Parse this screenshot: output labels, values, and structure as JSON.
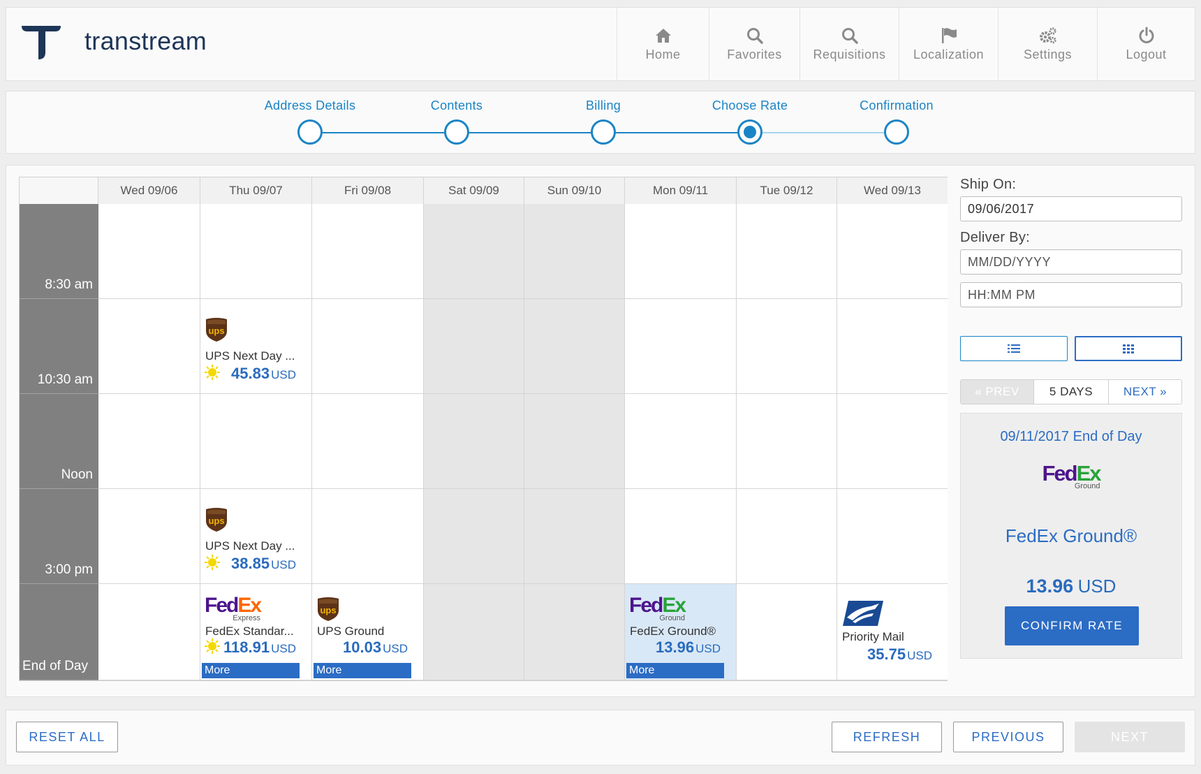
{
  "app": {
    "name": "transtream"
  },
  "nav": [
    {
      "label": "Home",
      "icon": "home-icon"
    },
    {
      "label": "Favorites",
      "icon": "search-icon"
    },
    {
      "label": "Requisitions",
      "icon": "search-icon"
    },
    {
      "label": "Localization",
      "icon": "flag-icon"
    },
    {
      "label": "Settings",
      "icon": "gears-icon"
    },
    {
      "label": "Logout",
      "icon": "power-icon"
    }
  ],
  "steps": [
    {
      "label": "Address Details",
      "state": "done"
    },
    {
      "label": "Contents",
      "state": "done"
    },
    {
      "label": "Billing",
      "state": "done"
    },
    {
      "label": "Choose Rate",
      "state": "active"
    },
    {
      "label": "Confirmation",
      "state": "pending"
    }
  ],
  "calendar": {
    "days": [
      "Wed 09/06",
      "Thu 09/07",
      "Fri 09/08",
      "Sat 09/09",
      "Sun 09/10",
      "Mon 09/11",
      "Tue 09/12",
      "Wed 09/13"
    ],
    "times": [
      "8:30 am",
      "10:30 am",
      "Noon",
      "3:00 pm",
      "End of Day"
    ],
    "rates": [
      {
        "carrier": "ups",
        "service": "UPS Next Day ...",
        "price": "45.83",
        "currency": "USD",
        "more": ""
      },
      {
        "carrier": "ups",
        "service": "UPS Next Day ...",
        "price": "38.85",
        "currency": "USD",
        "more": ""
      },
      {
        "carrier": "fedex-express",
        "service": "FedEx Standar...",
        "price": "118.91",
        "currency": "USD",
        "more": "More"
      },
      {
        "carrier": "ups",
        "service": "UPS Ground",
        "price": "10.03",
        "currency": "USD",
        "more": "More"
      },
      {
        "carrier": "fedex-ground",
        "service": "FedEx Ground®",
        "price": "13.96",
        "currency": "USD",
        "more": "More"
      },
      {
        "carrier": "usps",
        "service": "Priority Mail",
        "price": "35.75",
        "currency": "USD",
        "more": ""
      }
    ],
    "fedex": {
      "fed": "Fed",
      "ex": "Ex",
      "express_sub": "Express",
      "ground_sub": "Ground"
    },
    "ups_text": "ups"
  },
  "side": {
    "ship_on_label": "Ship On:",
    "ship_on_value": "09/06/2017",
    "deliver_by_label": "Deliver By:",
    "date_placeholder": "MM/DD/YYYY",
    "time_placeholder": "HH:MM PM",
    "pager": {
      "prev": "« PREV",
      "days": "5 DAYS",
      "next": "NEXT »"
    },
    "summary": {
      "date": "09/11/2017 End of Day",
      "service": "FedEx Ground®",
      "price": "13.96",
      "currency": "USD",
      "confirm": "CONFIRM RATE"
    }
  },
  "footer": {
    "reset": "RESET ALL",
    "refresh": "REFRESH",
    "previous": "PREVIOUS",
    "next": "NEXT"
  },
  "colors": {
    "accent": "#1b84c5",
    "primary": "#2b6cc4",
    "time_column": "#808080",
    "weekend": "#e6e6e6",
    "selected": "#d9e8f6",
    "ups_brown": "#5c3317",
    "ups_gold": "#f5b400",
    "fedex_purple": "#4d148c",
    "fedex_orange": "#ff6600",
    "fedex_green": "#29a33a",
    "usps_blue": "#1a4a94"
  }
}
